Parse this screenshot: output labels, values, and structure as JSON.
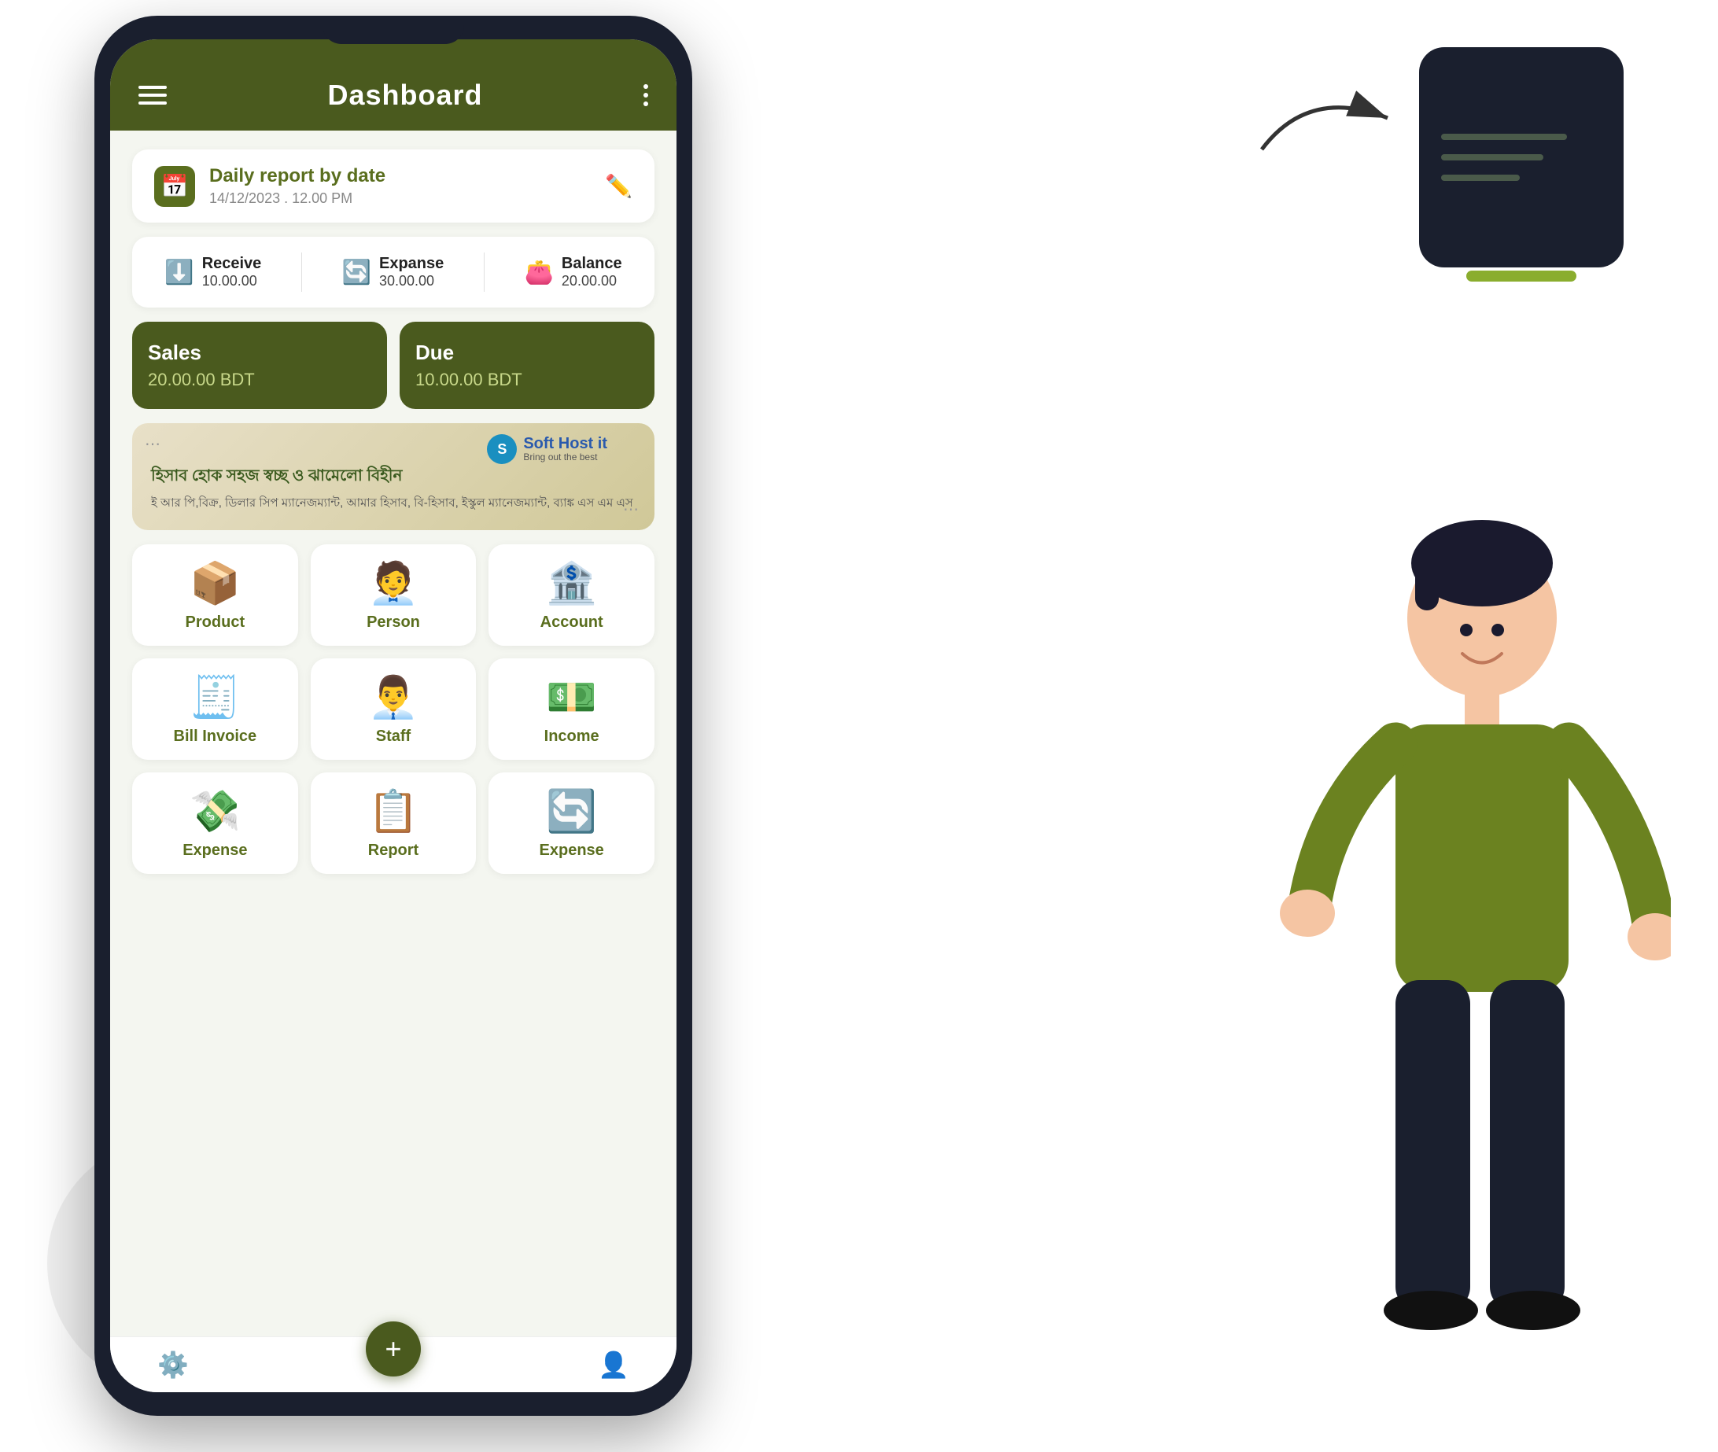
{
  "header": {
    "title": "Dashboard",
    "menu_label": "menu",
    "dots_label": "more options"
  },
  "daily_report": {
    "title": "Daily report by date",
    "datetime": "14/12/2023 . 12.00 PM",
    "edit_label": "edit"
  },
  "stats": {
    "receive": {
      "label": "Receive",
      "value": "10.00.00",
      "icon": "⬇"
    },
    "expanse": {
      "label": "Expanse",
      "value": "30.00.00",
      "icon": "↻"
    },
    "balance": {
      "label": "Balance",
      "value": "20.00.00",
      "icon": "💰"
    }
  },
  "cards": {
    "sales": {
      "label": "Sales",
      "value": "20.00.00 BDT"
    },
    "due": {
      "label": "Due",
      "value": "10.00.00 BDT"
    }
  },
  "banner": {
    "logo_name": "Soft Host it",
    "logo_tagline": "Bring out the best",
    "main_text": "হিসাব হোক সহজ স্বচ্ছ ও ঝামেলো বিহীন",
    "sub_text": "ই আর পি,বিক্র, ডিলার সিপ ম্যানেজম্যান্ট, আমার হিসাব,\nবি-হিসাব, ইস্কুল ম্যানেজম্যান্ট, ব্যাঙ্ক এস এম এস"
  },
  "menu_items": [
    {
      "label": "Product",
      "icon": "📦",
      "id": "product"
    },
    {
      "label": "Person",
      "icon": "🧑‍💼",
      "id": "person"
    },
    {
      "label": "Account",
      "icon": "🏦",
      "id": "account"
    },
    {
      "label": "Bill Invoice",
      "icon": "🧾",
      "id": "bill-invoice"
    },
    {
      "label": "Staff",
      "icon": "👨‍💼",
      "id": "staff"
    },
    {
      "label": "Income",
      "icon": "💵",
      "id": "income"
    },
    {
      "label": "Expense",
      "icon": "💸",
      "id": "expense1"
    },
    {
      "label": "Report",
      "icon": "📋",
      "id": "report"
    },
    {
      "label": "Expense",
      "icon": "🔄",
      "id": "expense2"
    }
  ],
  "bottom_nav": {
    "fab_label": "+",
    "settings_icon": "⚙",
    "profile_icon": "👤"
  },
  "decorations": {
    "note_card_visible": true,
    "person_visible": true
  }
}
